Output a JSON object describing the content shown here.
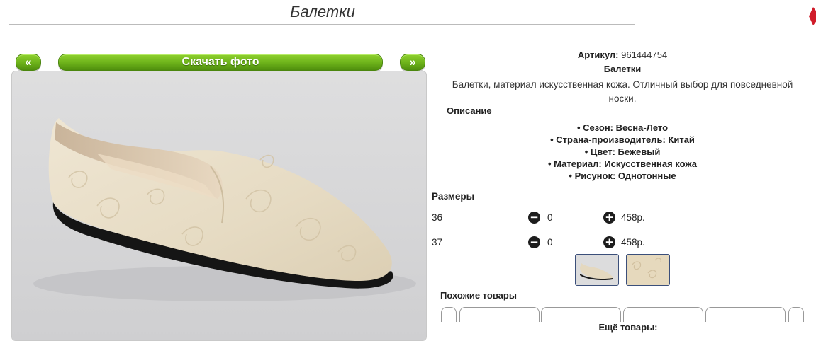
{
  "product": {
    "title": "Балетки",
    "sku_label": "Артикул:",
    "sku_value": "961444754",
    "name": "Балетки",
    "description": "Балетки, материал искусственная кожа. Отличный выбор для повседневной носки.",
    "description_heading": "Описание",
    "properties": [
      "Сезон: Весна-Лето",
      "Страна-производитель: Китай",
      "Цвет: Бежевый",
      "Материал: Искусственная кожа",
      "Рисунок: Однотонные"
    ]
  },
  "gallery": {
    "prev_label": "«",
    "next_label": "»",
    "download_label": "Скачать фото",
    "thumbnails": [
      "shoe-side-thumbnail",
      "texture-closeup-thumbnail"
    ]
  },
  "sizes": {
    "heading": "Размеры",
    "rows": [
      {
        "size": "36",
        "qty": "0",
        "price": "458р."
      },
      {
        "size": "37",
        "qty": "0",
        "price": "458р."
      }
    ],
    "minus_icon": "−",
    "plus_icon": "+"
  },
  "similar": {
    "heading": "Похожие товары"
  },
  "more": {
    "heading": "Ещё товары:"
  },
  "colors": {
    "accent_green": "#6cb11a",
    "corner_red": "#d01c2a"
  }
}
